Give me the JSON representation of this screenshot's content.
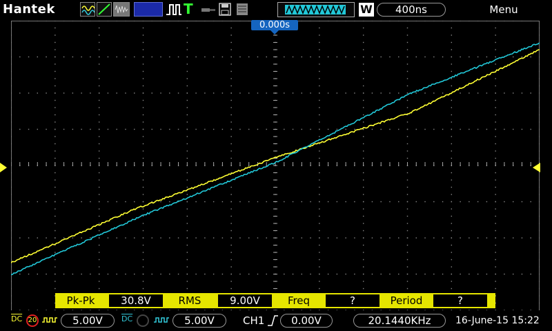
{
  "brand": "Hantek",
  "timebase": "400ns",
  "menu_label": "Menu",
  "trigger_position": "0.000s",
  "colors": {
    "ch1": "#ffff33",
    "ch2": "#22c8d8",
    "accent": "#1565c0",
    "meas_bar": "#e6e600"
  },
  "toolbar_icons": [
    "waveform-icon",
    "ramp-icon",
    "noise-icon",
    "run-state-icon",
    "pulse-icon",
    "trigger-t-icon",
    "probe-icon",
    "save-icon",
    "print-icon",
    "memory-depth-icon",
    "w-icon"
  ],
  "measurements": [
    {
      "label": "Pk-Pk",
      "value": "30.8V"
    },
    {
      "label": "RMS",
      "value": "9.00V"
    },
    {
      "label": "Freq",
      "value": "?"
    },
    {
      "label": "Period",
      "value": "?"
    }
  ],
  "ch1": {
    "coupling": "DC",
    "bw_limit": "20",
    "volts_div": "5.00V"
  },
  "ch2": {
    "coupling": "DC",
    "volts_div": "5.00V"
  },
  "trigger": {
    "source": "CH1",
    "level": "0.00V",
    "frequency": "20.1440KHz"
  },
  "datetime": "16-June-15 15:22"
}
